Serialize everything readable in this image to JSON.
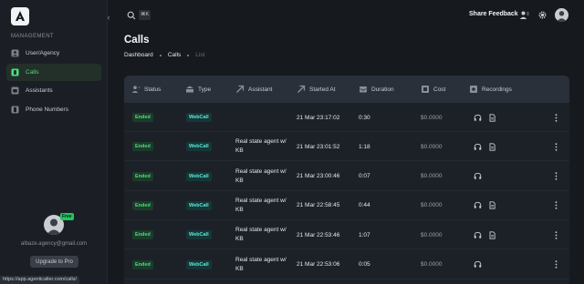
{
  "sidebar": {
    "section_label": "MANAGEMENT",
    "items": [
      {
        "label": "User/Agency",
        "icon": "user-square-icon",
        "active": false
      },
      {
        "label": "Calls",
        "icon": "calls-icon",
        "active": true
      },
      {
        "label": "Assistants",
        "icon": "assistant-icon",
        "active": false
      },
      {
        "label": "Phone Numbers",
        "icon": "phone-number-icon",
        "active": false
      }
    ],
    "profile": {
      "badge": "Free",
      "email": "albaze.agency@gmail.com"
    },
    "upgrade_label": "Upgrade to Pro",
    "status_url": "https://app.agenticaller.com/calls/"
  },
  "header": {
    "search_shortcut": "⌘K",
    "share_label": "Share Feedback"
  },
  "page": {
    "title": "Calls",
    "breadcrumb": [
      "Dashboard",
      "Calls",
      "List"
    ]
  },
  "table": {
    "columns": [
      "Status",
      "Type",
      "Assistant",
      "Started At",
      "Duration",
      "Cost",
      "Recordings"
    ],
    "rows": [
      {
        "status": "Ended",
        "type": "WebCall",
        "assistant": "",
        "started": "21 Mar 23:17:02",
        "duration": "0:30",
        "cost": "$0.0000",
        "has_doc": true
      },
      {
        "status": "Ended",
        "type": "WebCall",
        "assistant": "Real state agent w/ KB",
        "started": "21 Mar 23:01:52",
        "duration": "1:18",
        "cost": "$0.0000",
        "has_doc": true
      },
      {
        "status": "Ended",
        "type": "WebCall",
        "assistant": "Real state agent w/ KB",
        "started": "21 Mar 23:00:46",
        "duration": "0:07",
        "cost": "$0.0000",
        "has_doc": false
      },
      {
        "status": "Ended",
        "type": "WebCall",
        "assistant": "Real state agent w/ KB",
        "started": "21 Mar 22:58:45",
        "duration": "0:44",
        "cost": "$0.0000",
        "has_doc": true
      },
      {
        "status": "Ended",
        "type": "WebCall",
        "assistant": "Real state agent w/ KB",
        "started": "21 Mar 22:53:46",
        "duration": "1:07",
        "cost": "$0.0000",
        "has_doc": true
      },
      {
        "status": "Ended",
        "type": "WebCall",
        "assistant": "Real state agent w/ KB",
        "started": "21 Mar 22:53:06",
        "duration": "0:05",
        "cost": "$0.0000",
        "has_doc": false
      }
    ]
  }
}
